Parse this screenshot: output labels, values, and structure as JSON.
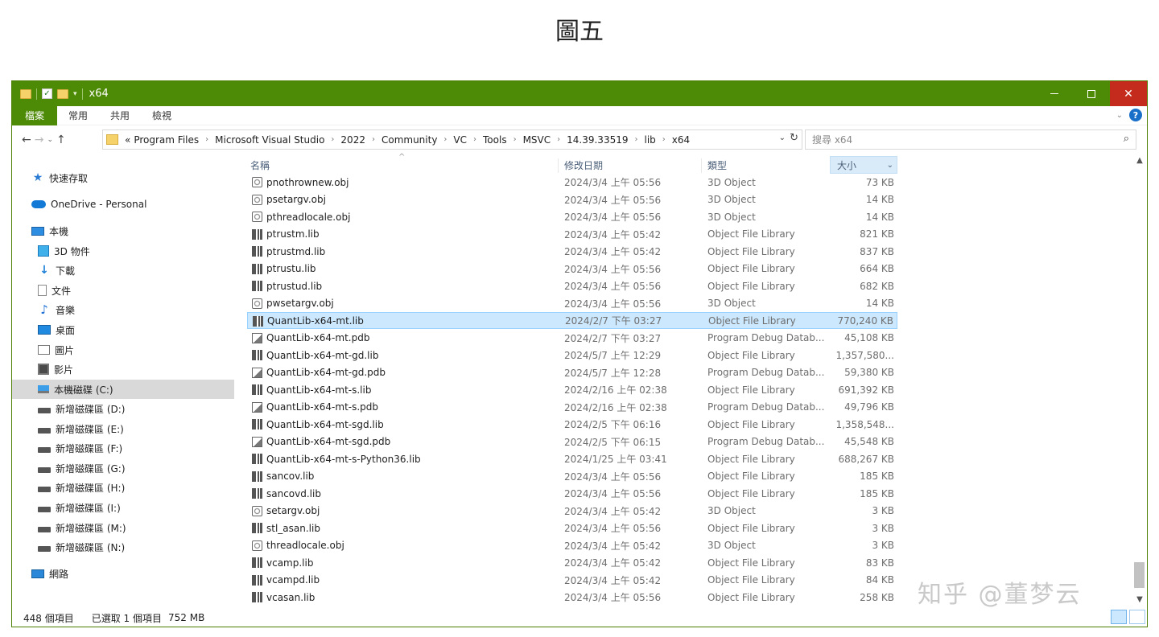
{
  "figure_caption": "圖五",
  "window": {
    "title": "x64",
    "controls": {
      "minimize": "—",
      "maximize": "☐",
      "close": "✕"
    }
  },
  "ribbon": {
    "tabs": [
      "檔案",
      "常用",
      "共用",
      "檢視"
    ],
    "help": "?"
  },
  "navigation": {
    "back": "←",
    "forward": "→",
    "recent": "⌄",
    "up": "↑"
  },
  "address": {
    "prefix": "«",
    "crumbs": [
      "Program Files",
      "Microsoft Visual Studio",
      "2022",
      "Community",
      "VC",
      "Tools",
      "MSVC",
      "14.39.33519",
      "lib",
      "x64"
    ]
  },
  "search": {
    "placeholder": "搜尋 x64"
  },
  "sidebar": {
    "items": [
      {
        "label": "快速存取",
        "icon": "star-icon"
      },
      {
        "label": "OneDrive - Personal",
        "icon": "cloud-icon"
      },
      {
        "label": "本機",
        "icon": "computer-icon"
      },
      {
        "label": "3D 物件",
        "icon": "cube-icon"
      },
      {
        "label": "下載",
        "icon": "download-icon"
      },
      {
        "label": "文件",
        "icon": "document-icon"
      },
      {
        "label": "音樂",
        "icon": "music-icon"
      },
      {
        "label": "桌面",
        "icon": "desktop-icon"
      },
      {
        "label": "圖片",
        "icon": "picture-icon"
      },
      {
        "label": "影片",
        "icon": "video-icon"
      },
      {
        "label": "本機磁碟 (C:)",
        "icon": "system-drive-icon",
        "selected": true
      },
      {
        "label": "新增磁碟區 (D:)",
        "icon": "drive-icon"
      },
      {
        "label": "新增磁碟區 (E:)",
        "icon": "drive-icon"
      },
      {
        "label": "新增磁碟區 (F:)",
        "icon": "drive-icon"
      },
      {
        "label": "新增磁碟區 (G:)",
        "icon": "drive-icon"
      },
      {
        "label": "新增磁碟區 (H:)",
        "icon": "drive-icon"
      },
      {
        "label": "新增磁碟區 (I:)",
        "icon": "drive-icon"
      },
      {
        "label": "新增磁碟區 (M:)",
        "icon": "drive-icon"
      },
      {
        "label": "新增磁碟區 (N:)",
        "icon": "drive-icon"
      },
      {
        "label": "網路",
        "icon": "network-icon"
      }
    ]
  },
  "columns": {
    "name": "名稱",
    "date": "修改日期",
    "type": "類型",
    "size": "大小"
  },
  "files": [
    {
      "name": "pnothrownew.obj",
      "date": "2024/3/4 上午 05:56",
      "type": "3D Object",
      "size": "73 KB",
      "kind": "obj"
    },
    {
      "name": "psetargv.obj",
      "date": "2024/3/4 上午 05:56",
      "type": "3D Object",
      "size": "14 KB",
      "kind": "obj"
    },
    {
      "name": "pthreadlocale.obj",
      "date": "2024/3/4 上午 05:56",
      "type": "3D Object",
      "size": "14 KB",
      "kind": "obj"
    },
    {
      "name": "ptrustm.lib",
      "date": "2024/3/4 上午 05:42",
      "type": "Object File Library",
      "size": "821 KB",
      "kind": "lib"
    },
    {
      "name": "ptrustmd.lib",
      "date": "2024/3/4 上午 05:42",
      "type": "Object File Library",
      "size": "837 KB",
      "kind": "lib"
    },
    {
      "name": "ptrustu.lib",
      "date": "2024/3/4 上午 05:56",
      "type": "Object File Library",
      "size": "664 KB",
      "kind": "lib"
    },
    {
      "name": "ptrustud.lib",
      "date": "2024/3/4 上午 05:56",
      "type": "Object File Library",
      "size": "682 KB",
      "kind": "lib"
    },
    {
      "name": "pwsetargv.obj",
      "date": "2024/3/4 上午 05:56",
      "type": "3D Object",
      "size": "14 KB",
      "kind": "obj"
    },
    {
      "name": "QuantLib-x64-mt.lib",
      "date": "2024/2/7 下午 03:27",
      "type": "Object File Library",
      "size": "770,240 KB",
      "kind": "lib",
      "selected": true
    },
    {
      "name": "QuantLib-x64-mt.pdb",
      "date": "2024/2/7 下午 03:27",
      "type": "Program Debug Datab...",
      "size": "45,108 KB",
      "kind": "pdb"
    },
    {
      "name": "QuantLib-x64-mt-gd.lib",
      "date": "2024/5/7 上午 12:29",
      "type": "Object File Library",
      "size": "1,357,580...",
      "kind": "lib"
    },
    {
      "name": "QuantLib-x64-mt-gd.pdb",
      "date": "2024/5/7 上午 12:28",
      "type": "Program Debug Datab...",
      "size": "59,380 KB",
      "kind": "pdb"
    },
    {
      "name": "QuantLib-x64-mt-s.lib",
      "date": "2024/2/16 上午 02:38",
      "type": "Object File Library",
      "size": "691,392 KB",
      "kind": "lib"
    },
    {
      "name": "QuantLib-x64-mt-s.pdb",
      "date": "2024/2/16 上午 02:38",
      "type": "Program Debug Datab...",
      "size": "49,796 KB",
      "kind": "pdb"
    },
    {
      "name": "QuantLib-x64-mt-sgd.lib",
      "date": "2024/2/5 下午 06:16",
      "type": "Object File Library",
      "size": "1,358,548...",
      "kind": "lib"
    },
    {
      "name": "QuantLib-x64-mt-sgd.pdb",
      "date": "2024/2/5 下午 06:15",
      "type": "Program Debug Datab...",
      "size": "45,548 KB",
      "kind": "pdb"
    },
    {
      "name": "QuantLib-x64-mt-s-Python36.lib",
      "date": "2024/1/25 上午 03:41",
      "type": "Object File Library",
      "size": "688,267 KB",
      "kind": "lib"
    },
    {
      "name": "sancov.lib",
      "date": "2024/3/4 上午 05:56",
      "type": "Object File Library",
      "size": "185 KB",
      "kind": "lib"
    },
    {
      "name": "sancovd.lib",
      "date": "2024/3/4 上午 05:56",
      "type": "Object File Library",
      "size": "185 KB",
      "kind": "lib"
    },
    {
      "name": "setargv.obj",
      "date": "2024/3/4 上午 05:42",
      "type": "3D Object",
      "size": "3 KB",
      "kind": "obj"
    },
    {
      "name": "stl_asan.lib",
      "date": "2024/3/4 上午 05:56",
      "type": "Object File Library",
      "size": "3 KB",
      "kind": "lib"
    },
    {
      "name": "threadlocale.obj",
      "date": "2024/3/4 上午 05:42",
      "type": "3D Object",
      "size": "3 KB",
      "kind": "obj"
    },
    {
      "name": "vcamp.lib",
      "date": "2024/3/4 上午 05:42",
      "type": "Object File Library",
      "size": "83 KB",
      "kind": "lib"
    },
    {
      "name": "vcampd.lib",
      "date": "2024/3/4 上午 05:42",
      "type": "Object File Library",
      "size": "84 KB",
      "kind": "lib"
    },
    {
      "name": "vcasan.lib",
      "date": "2024/3/4 上午 05:56",
      "type": "Object File Library",
      "size": "258 KB",
      "kind": "lib"
    }
  ],
  "status": {
    "item_count": "448 個項目",
    "selection": "已選取 1 個項目",
    "selection_size": "752 MB"
  },
  "watermark": "知乎 @董梦云",
  "colors": {
    "titlebar": "#4d8a05",
    "selection": "#cce8ff",
    "close": "#c42b1c"
  }
}
